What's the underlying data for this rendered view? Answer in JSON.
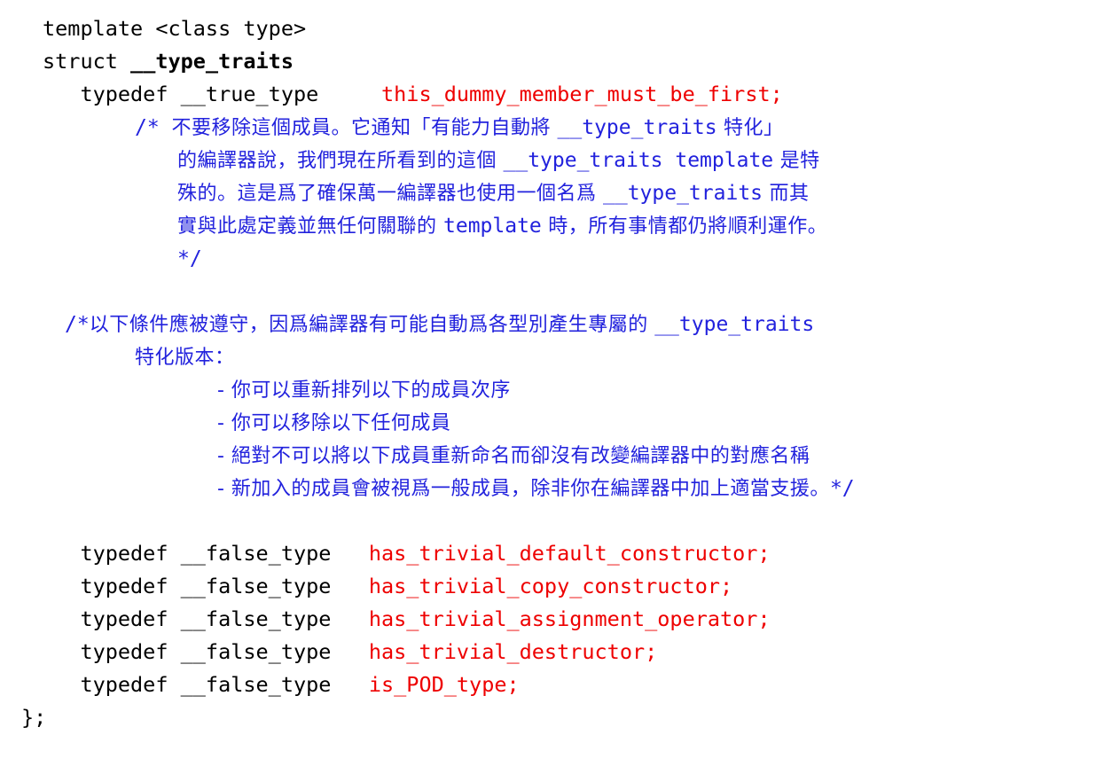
{
  "document": {
    "kind": "source-code-listing",
    "language": "C++",
    "colors": {
      "code": "#000000",
      "identifier_red": "#ee0000",
      "comment_blue": "#2222dd",
      "background": "#ffffff"
    }
  },
  "lines": {
    "l1_template": "template <class type>",
    "l2_struct_kw": "struct ",
    "l2_struct_name": "__type_traits",
    "l3_typedef": "   typedef __true_type     ",
    "l3_member": "this_dummy_member_must_be_first;",
    "c1_line1_open": "/* ",
    "c1_line1_a": "不要移除這個成員。它通知「有能力自動將 ",
    "c1_line1_mono": "__type_traits",
    "c1_line1_b": " 特化」",
    "c1_line2_a": "的編譯器說，我們現在所看到的這個 ",
    "c1_line2_mono": "__type_traits template",
    "c1_line2_b": " 是特",
    "c1_line3_a": "殊的。這是爲了確保萬一編譯器也使用一個名爲 ",
    "c1_line3_mono": "__type_traits",
    "c1_line3_b": " 而其",
    "c1_line4_a": "實與此處定義並無任何關聯的 ",
    "c1_line4_mono": "template",
    "c1_line4_b": " 時，所有事情都仍將順利運作。",
    "c1_close": "*/",
    "c2_line1_open": "/*",
    "c2_line1_a": "以下條件應被遵守，因爲編譯器有可能自動爲各型別產生專屬的 ",
    "c2_line1_mono": "__type_traits",
    "c2_line2": "特化版本：",
    "c2_bullet1": "- 你可以重新排列以下的成員次序",
    "c2_bullet2": "- 你可以移除以下任何成員",
    "c2_bullet3": "- 絕對不可以將以下成員重新命名而卻沒有改變編譯器中的對應名稱",
    "c2_bullet4_a": "- 新加入的成員會被視爲一般成員，除非你在編譯器中加上適當支援。",
    "c2_bullet4_close": "*/",
    "closing_brace": "};"
  },
  "typedefs": [
    {
      "keyword": "   typedef __false_type   ",
      "name": "has_trivial_default_constructor;"
    },
    {
      "keyword": "   typedef __false_type   ",
      "name": "has_trivial_copy_constructor;"
    },
    {
      "keyword": "   typedef __false_type   ",
      "name": "has_trivial_assignment_operator;"
    },
    {
      "keyword": "   typedef __false_type   ",
      "name": "has_trivial_destructor;"
    },
    {
      "keyword": "   typedef __false_type   ",
      "name": "is_POD_type;"
    }
  ]
}
